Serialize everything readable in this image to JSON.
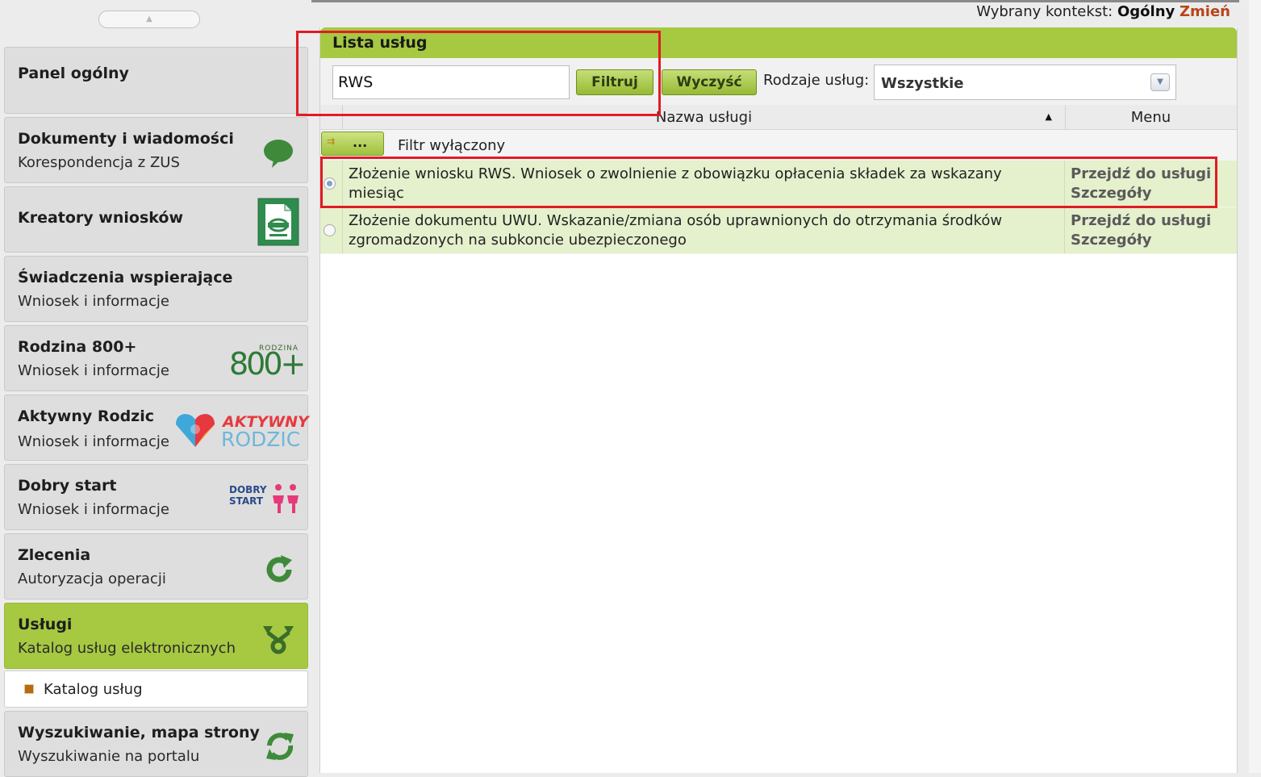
{
  "sidebar": {
    "items": [
      {
        "title": "Panel ogólny",
        "subtitle": ""
      },
      {
        "title": "Dokumenty i wiadomości",
        "subtitle": "Korespondencja z ZUS",
        "icon": "speech-bubble-icon"
      },
      {
        "title": "Kreatory wniosków",
        "subtitle": "",
        "icon": "document-form-icon"
      },
      {
        "title": "Świadczenia wspierające",
        "subtitle": "Wniosek i informacje"
      },
      {
        "title": "Rodzina 800+",
        "subtitle": "Wniosek i informacje",
        "icon": "rodzina-800-logo",
        "logo_text": "RODZINA",
        "logo_number": "800+"
      },
      {
        "title": "Aktywny Rodzic",
        "subtitle": "Wniosek i informacje",
        "icon": "aktywny-rodzic-logo",
        "logo_line1": "AKTYWNY",
        "logo_line2": "RODZIC"
      },
      {
        "title": "Dobry start",
        "subtitle": "Wniosek i informacje",
        "icon": "dobry-start-logo",
        "logo_line1": "DOBRY",
        "logo_line2": "START"
      },
      {
        "title": "Zlecenia",
        "subtitle": "Autoryzacja operacji",
        "icon": "refresh-arrow-icon"
      },
      {
        "title": "Usługi",
        "subtitle": "Katalog usług elektronicznych",
        "icon": "merge-arrows-icon",
        "active": true
      },
      {
        "title": "Wyszukiwanie, mapa strony",
        "subtitle": "Wyszukiwanie na portalu",
        "icon": "sync-arrows-icon"
      }
    ],
    "subitem": {
      "label": "Katalog usług"
    }
  },
  "context": {
    "label": "Wybrany kontekst:",
    "value": "Ogólny",
    "change": "Zmień"
  },
  "panel": {
    "title": "Lista usług",
    "search_value": "RWS",
    "filter_button": "Filtruj",
    "clear_button": "Wyczyść",
    "types_label": "Rodzaje usług:",
    "types_selected": "Wszystkie",
    "columns": {
      "name": "Nazwa usługi",
      "menu": "Menu"
    },
    "filter_button_dots": "...",
    "filter_status": "Filtr wyłączony",
    "rows": [
      {
        "name": "Złożenie wniosku RWS. Wniosek o zwolnienie z obowiązku opłacenia składek za wskazany miesiąc",
        "action": "Przejdź do usługi",
        "details": "Szczegóły",
        "selected": true
      },
      {
        "name": "Złożenie dokumentu UWU. Wskazanie/zmiana osób uprawnionych do otrzymania środków zgromadzonych na subkoncie ubezpieczonego",
        "action": "Przejdź do usługi",
        "details": "Szczegóły",
        "selected": false
      }
    ]
  },
  "colors": {
    "accent_green": "#a6c941",
    "row_green": "#e5f0cd",
    "highlight_red": "#e01c24",
    "change_link": "#b8441a"
  }
}
